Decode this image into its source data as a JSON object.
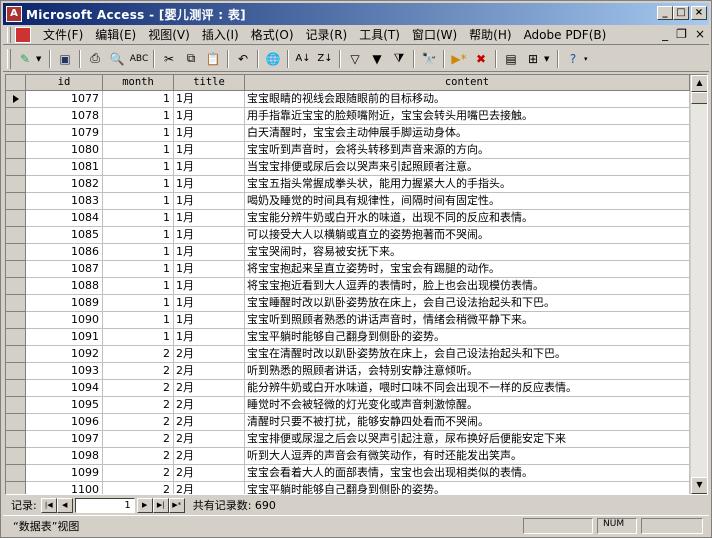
{
  "window": {
    "title": "Microsoft Access - [婴儿测评 : 表]",
    "app_icon_text": "A"
  },
  "menu": {
    "items": [
      "文件(F)",
      "编辑(E)",
      "视图(V)",
      "插入(I)",
      "格式(O)",
      "记录(R)",
      "工具(T)",
      "窗口(W)",
      "帮助(H)",
      "Adobe PDF(B)"
    ]
  },
  "table": {
    "columns": [
      "id",
      "month",
      "title",
      "content"
    ],
    "rows": [
      {
        "id": "1077",
        "month": "1",
        "title": "1月",
        "content": "宝宝眼睛的视线会跟随眼前的目标移动。"
      },
      {
        "id": "1078",
        "month": "1",
        "title": "1月",
        "content": "用手指靠近宝宝的脸颊嘴附近，宝宝会转头用嘴巴去接触。"
      },
      {
        "id": "1079",
        "month": "1",
        "title": "1月",
        "content": "白天清醒时，宝宝会主动伸展手脚运动身体。"
      },
      {
        "id": "1080",
        "month": "1",
        "title": "1月",
        "content": "宝宝听到声音时，会将头转移到声音来源的方向。"
      },
      {
        "id": "1081",
        "month": "1",
        "title": "1月",
        "content": "当宝宝排便或尿后会以哭声来引起照顾者注意。"
      },
      {
        "id": "1082",
        "month": "1",
        "title": "1月",
        "content": "宝宝五指头常握成拳头状，能用力握紧大人的手指头。"
      },
      {
        "id": "1083",
        "month": "1",
        "title": "1月",
        "content": "喝奶及睡觉的时间具有规律性，间隔时间有固定性。"
      },
      {
        "id": "1084",
        "month": "1",
        "title": "1月",
        "content": "宝宝能分辨牛奶或白开水的味道，出现不同的反应和表情。"
      },
      {
        "id": "1085",
        "month": "1",
        "title": "1月",
        "content": "可以接受大人以横躺或直立的姿势抱著而不哭闹。"
      },
      {
        "id": "1086",
        "month": "1",
        "title": "1月",
        "content": "宝宝哭闹时，容易被安抚下来。"
      },
      {
        "id": "1087",
        "month": "1",
        "title": "1月",
        "content": "将宝宝抱起来呈直立姿势时，宝宝会有踢腿的动作。"
      },
      {
        "id": "1088",
        "month": "1",
        "title": "1月",
        "content": "将宝宝抱近看到大人逗弄的表情时，脸上也会出现模仿表情。"
      },
      {
        "id": "1089",
        "month": "1",
        "title": "1月",
        "content": "宝宝睡醒时改以趴卧姿势放在床上，会自己设法抬起头和下巴。"
      },
      {
        "id": "1090",
        "month": "1",
        "title": "1月",
        "content": "宝宝听到照顾者熟悉的讲话声音时，情绪会稍微平静下来。"
      },
      {
        "id": "1091",
        "month": "1",
        "title": "1月",
        "content": "宝宝平躺时能够自己翻身到侧卧的姿势。"
      },
      {
        "id": "1092",
        "month": "2",
        "title": "2月",
        "content": "宝宝在清醒时改以趴卧姿势放在床上，会自己设法抬起头和下巴。"
      },
      {
        "id": "1093",
        "month": "2",
        "title": "2月",
        "content": "听到熟悉的照顾者讲话，会特别安静注意倾听。"
      },
      {
        "id": "1094",
        "month": "2",
        "title": "2月",
        "content": "能分辨牛奶或白开水味道，喂时口味不同会出现不一样的反应表情。"
      },
      {
        "id": "1095",
        "month": "2",
        "title": "2月",
        "content": "睡觉时不会被轻微的灯光变化或声音刺激惊醒。"
      },
      {
        "id": "1096",
        "month": "2",
        "title": "2月",
        "content": "清醒时只要不被打扰，能够安静四处看而不哭闹。"
      },
      {
        "id": "1097",
        "month": "2",
        "title": "2月",
        "content": "宝宝排便或尿湿之后会以哭声引起注意，尿布换好后便能安定下来"
      },
      {
        "id": "1098",
        "month": "2",
        "title": "2月",
        "content": "听到大人逗弄的声音会有微笑动作，有时还能发出笑声。"
      },
      {
        "id": "1099",
        "month": "2",
        "title": "2月",
        "content": "宝宝会看着大人的面部表情，宝宝也会出现相类似的表情。"
      },
      {
        "id": "1100",
        "month": "2",
        "title": "2月",
        "content": "宝宝平躺时能够自己翻身到侧卧的姿势。"
      }
    ]
  },
  "navigator": {
    "label": "记录:",
    "current": "1",
    "count_text": "共有记录数: 690"
  },
  "status": {
    "view_text": "“数据表”视图",
    "num_indicator": "NUM"
  }
}
